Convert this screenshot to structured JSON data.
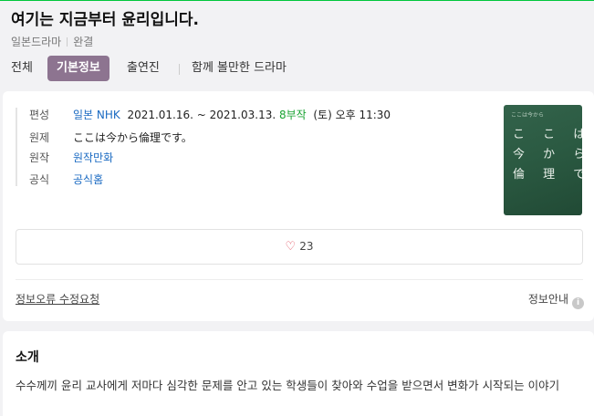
{
  "header": {
    "title": "여기는 지금부터 윤리입니다.",
    "meta": [
      "일본드라마",
      "완결"
    ]
  },
  "tabs": [
    {
      "label": "전체"
    },
    {
      "label": "기본정보",
      "active": true
    },
    {
      "label": "출연진"
    },
    {
      "label": "함께 볼만한 드라마"
    }
  ],
  "info": {
    "broadcast": {
      "label": "편성",
      "country": "일본",
      "network": "NHK",
      "dates": "2021.01.16. ~ 2021.03.13.",
      "episodes": "8부작",
      "schedule": "(토) 오후 11:30"
    },
    "original_title": {
      "label": "원제",
      "value": "ここは今から倫理です。"
    },
    "source": {
      "label": "원작",
      "value": "원작만화"
    },
    "official": {
      "label": "공식",
      "value": "공식홈"
    }
  },
  "poster": {
    "small_text": "ここは今から",
    "line1": "こ こ は",
    "line2": "今 か ら",
    "line3": "倫 理 で す 。"
  },
  "like": {
    "count": "23",
    "icon": "heart-icon"
  },
  "footer": {
    "report_label": "정보오류 수정요청",
    "guide_label": "정보안내",
    "guide_icon": "info-icon"
  },
  "intro": {
    "title": "소개",
    "text": "수수께끼 윤리 교사에게 저마다 심각한 문제를 안고 있는 학생들이 찾아와 수업을 받으면서 변화가 시작되는 이야기"
  },
  "colors": {
    "accent_tab": "#8d7490",
    "link": "#1a6ac2",
    "episodes": "#19a332",
    "heart": "#e04a5a"
  }
}
